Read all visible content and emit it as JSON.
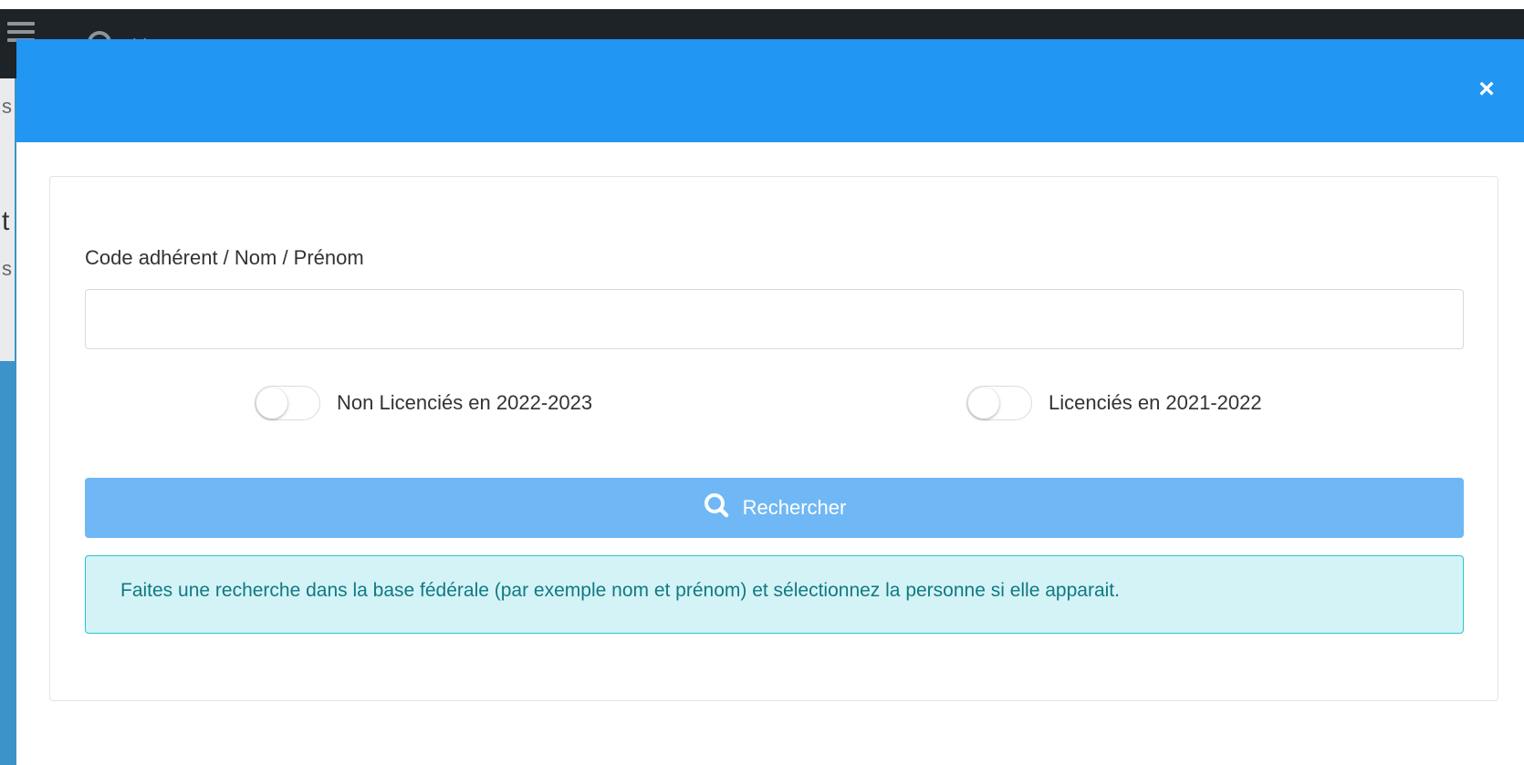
{
  "background": {
    "peek_letters": [
      "s",
      "t",
      "s"
    ]
  },
  "modal": {
    "close_label": "×",
    "form": {
      "field_label": "Code adhérent / Nom / Prénom",
      "input_value": "",
      "toggles": [
        {
          "label": "Non Licenciés en 2022-2023",
          "checked": false
        },
        {
          "label": "Licenciés en 2021-2022",
          "checked": false
        }
      ],
      "search_button_label": "Rechercher",
      "info_message": "Faites une recherche dans la base fédérale (par exemple nom et prénom) et sélectionnez la personne si elle apparait."
    }
  },
  "colors": {
    "header": "#2196f3",
    "button": "#6fb8f5",
    "info_bg": "#d4f3f7",
    "info_border": "#27c5cf",
    "info_text": "#0f7a82"
  },
  "icons": [
    "hamburger-icon",
    "search-icon",
    "chevron-down-icon",
    "close-icon"
  ]
}
